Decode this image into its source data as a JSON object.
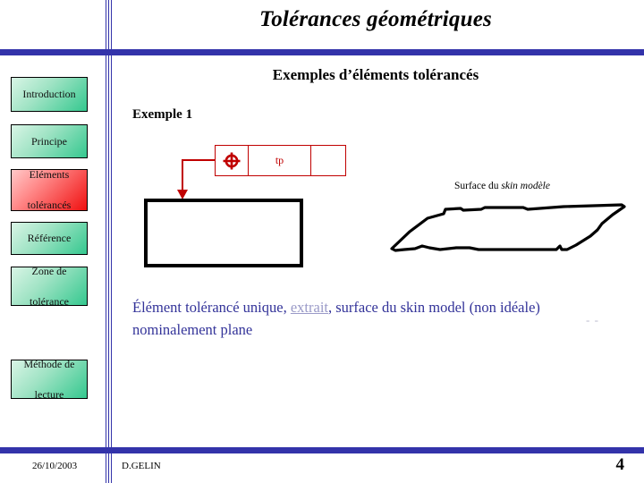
{
  "slide": {
    "title": "Tolérances géométriques",
    "section_heading": "Exemples d’éléments tolérancés",
    "example_label": "Exemple 1"
  },
  "sidebar": {
    "items": [
      {
        "id": "introduction",
        "label": "Introduction",
        "state": "normal"
      },
      {
        "id": "principe",
        "label": "Principe",
        "state": "normal"
      },
      {
        "id": "elements-tolerances",
        "label_line1": "Eléments",
        "label_line2": "tolérancés",
        "state": "active"
      },
      {
        "id": "reference",
        "label": "Référence",
        "state": "normal"
      },
      {
        "id": "zone-de-tolerance",
        "label_line1": "Zone de",
        "label_line2": "tolérance",
        "state": "normal"
      },
      {
        "id": "methode-de-lecture",
        "label_line1": "Méthode de",
        "label_line2": "lecture",
        "state": "normal"
      }
    ],
    "colors": {
      "normal_accent": "#35c88f",
      "active_accent": "#f01010"
    }
  },
  "diagram": {
    "tolerance_frame": {
      "symbol_name": "position-symbol",
      "symbol_glyph": "⊕",
      "tolerance_value": "tp",
      "datum": "",
      "color": "#c00000"
    },
    "nominal_surface_label": "",
    "skin_surface": {
      "caption_prefix": "Surface du ",
      "caption_italic": "skin modèle"
    }
  },
  "body": {
    "caption_part1": "Élément tolérancé unique, ",
    "caption_link": "extrait",
    "caption_part2": ", surface du skin model (non idéale) nominalement plane",
    "text_color": "#333399",
    "link_color": "#9a9ac8",
    "dash_mark": "- -"
  },
  "footer": {
    "date": "26/10/2003",
    "author": "D.GELIN",
    "page_number": "4"
  },
  "theme": {
    "rule_color": "#3333aa"
  }
}
